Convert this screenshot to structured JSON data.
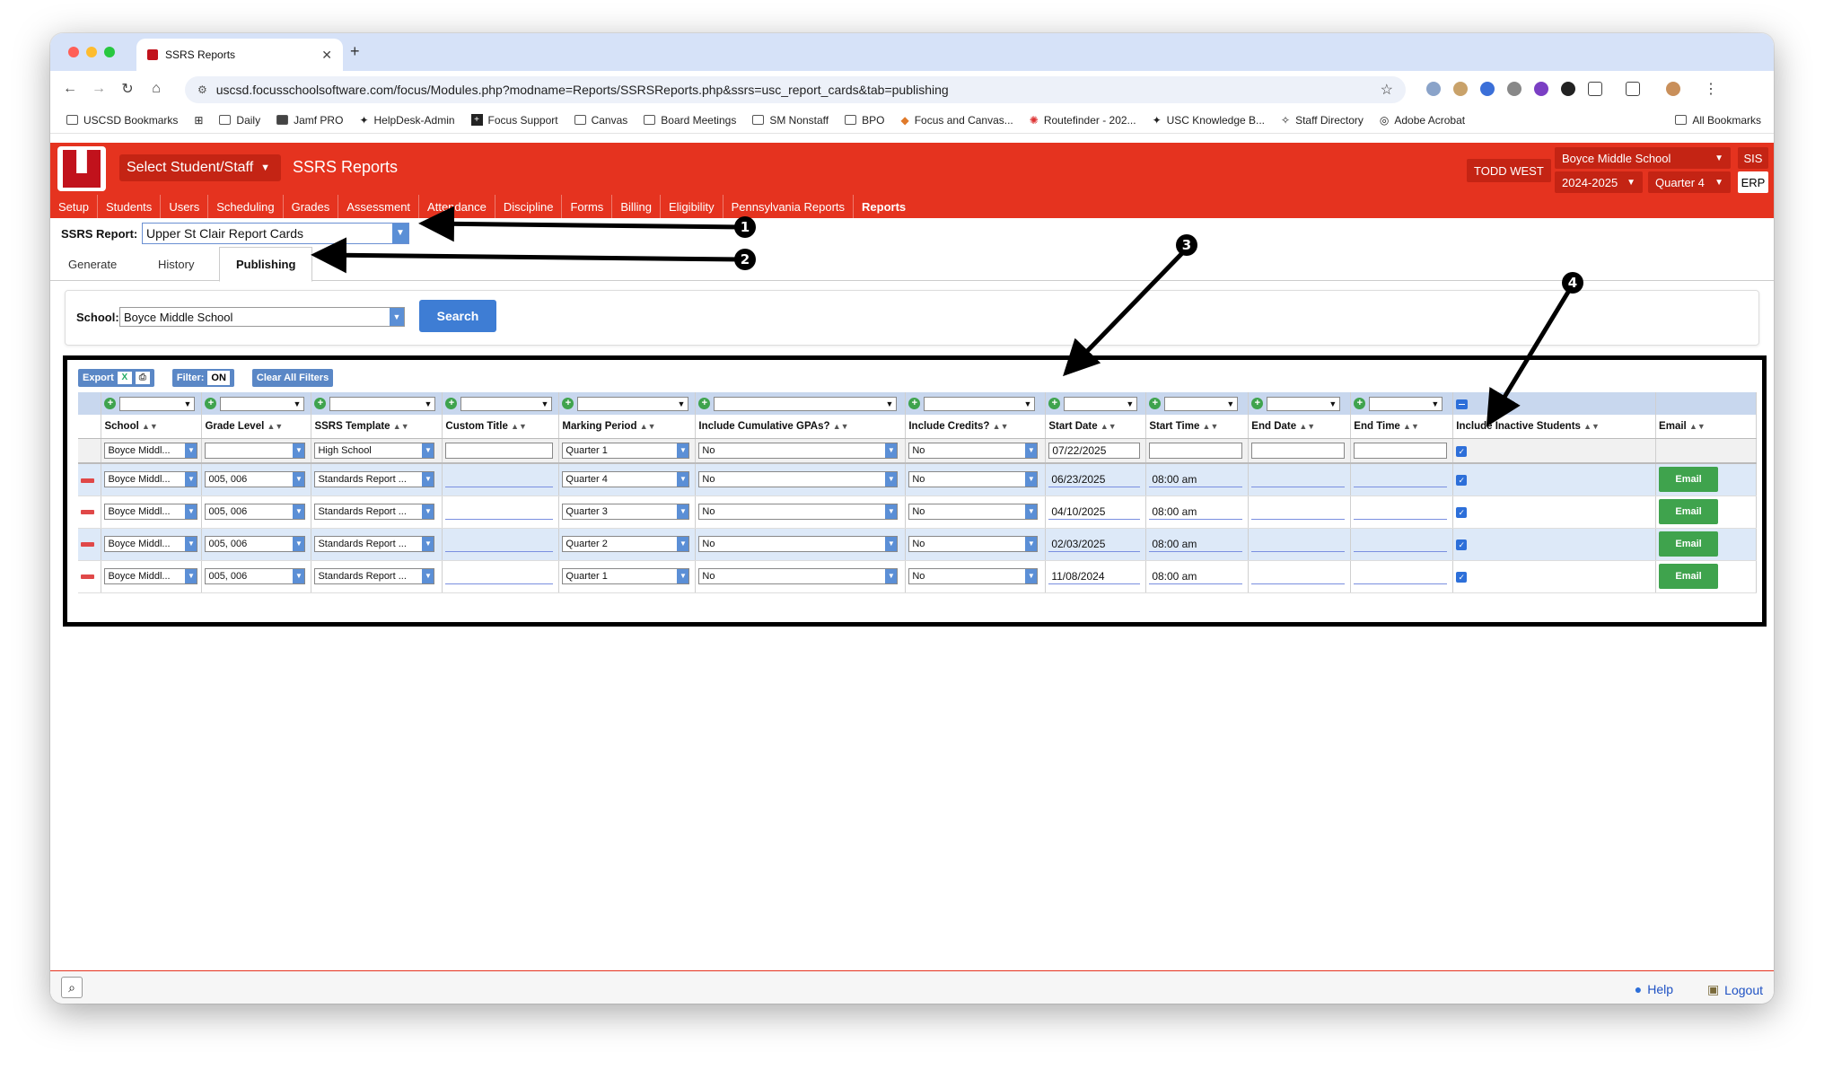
{
  "browser": {
    "tab_title": "SSRS Reports",
    "new_tab": "+",
    "url": "uscsd.focusschoolsoftware.com/focus/Modules.php?modname=Reports/SSRSReports.php&ssrs=usc_report_cards&tab=publishing",
    "bookmarks": [
      "USCSD Bookmarks",
      "Daily",
      "Jamf PRO",
      "HelpDesk-Admin",
      "Focus Support",
      "Canvas",
      "Board Meetings",
      "SM Nonstaff",
      "BPO",
      "Focus and Canvas...",
      "Routefinder - 202...",
      "USC Knowledge B...",
      "Staff Directory",
      "Adobe Acrobat"
    ],
    "all_bookmarks": "All Bookmarks"
  },
  "header": {
    "select_student_staff": "Select Student/Staff",
    "title": "SSRS Reports",
    "user": "TODD WEST",
    "school": "Boyce Middle School",
    "year": "2024-2025",
    "quarter": "Quarter 4",
    "sis": "SIS",
    "erp": "ERP"
  },
  "menu": [
    "Setup",
    "Students",
    "Users",
    "Scheduling",
    "Grades",
    "Assessment",
    "Attendance",
    "Discipline",
    "Forms",
    "Billing",
    "Eligibility",
    "Pennsylvania Reports",
    "Reports"
  ],
  "report": {
    "label": "SSRS Report:",
    "value": "Upper St Clair Report Cards"
  },
  "tabs": [
    "Generate",
    "History",
    "Publishing"
  ],
  "school_filter": {
    "label": "School:",
    "value": "Boyce Middle School",
    "search": "Search"
  },
  "grid_tools": {
    "export": "Export",
    "filter": "Filter:",
    "filter_state": "ON",
    "clear_filters": "Clear All Filters"
  },
  "columns": [
    "School",
    "Grade Level",
    "SSRS Template",
    "Custom Title",
    "Marking Period",
    "Include Cumulative GPAs?",
    "Include Credits?",
    "Start Date",
    "Start Time",
    "End Date",
    "End Time",
    "Include Inactive Students",
    "Email"
  ],
  "new_row": {
    "school": "Boyce Middl...",
    "grade": "",
    "template": "High School",
    "custom_title": "",
    "marking_period": "Quarter 1",
    "gpas": "No",
    "credits": "No",
    "start_date": "07/22/2025",
    "start_time": "",
    "end_date": "",
    "end_time": ""
  },
  "rows": [
    {
      "school": "Boyce Middl...",
      "grade": "005, 006",
      "template": "Standards Report ...",
      "marking_period": "Quarter 4",
      "gpas": "No",
      "credits": "No",
      "start_date": "06/23/2025",
      "start_time": "08:00 am",
      "email": "Email"
    },
    {
      "school": "Boyce Middl...",
      "grade": "005, 006",
      "template": "Standards Report ...",
      "marking_period": "Quarter 3",
      "gpas": "No",
      "credits": "No",
      "start_date": "04/10/2025",
      "start_time": "08:00 am",
      "email": "Email"
    },
    {
      "school": "Boyce Middl...",
      "grade": "005, 006",
      "template": "Standards Report ...",
      "marking_period": "Quarter 2",
      "gpas": "No",
      "credits": "No",
      "start_date": "02/03/2025",
      "start_time": "08:00 am",
      "email": "Email"
    },
    {
      "school": "Boyce Middl...",
      "grade": "005, 006",
      "template": "Standards Report ...",
      "marking_period": "Quarter 1",
      "gpas": "No",
      "credits": "No",
      "start_date": "11/08/2024",
      "start_time": "08:00 am",
      "email": "Email"
    }
  ],
  "footer": {
    "help": "Help",
    "logout": "Logout"
  },
  "annotations": [
    "1",
    "2",
    "3",
    "4"
  ]
}
